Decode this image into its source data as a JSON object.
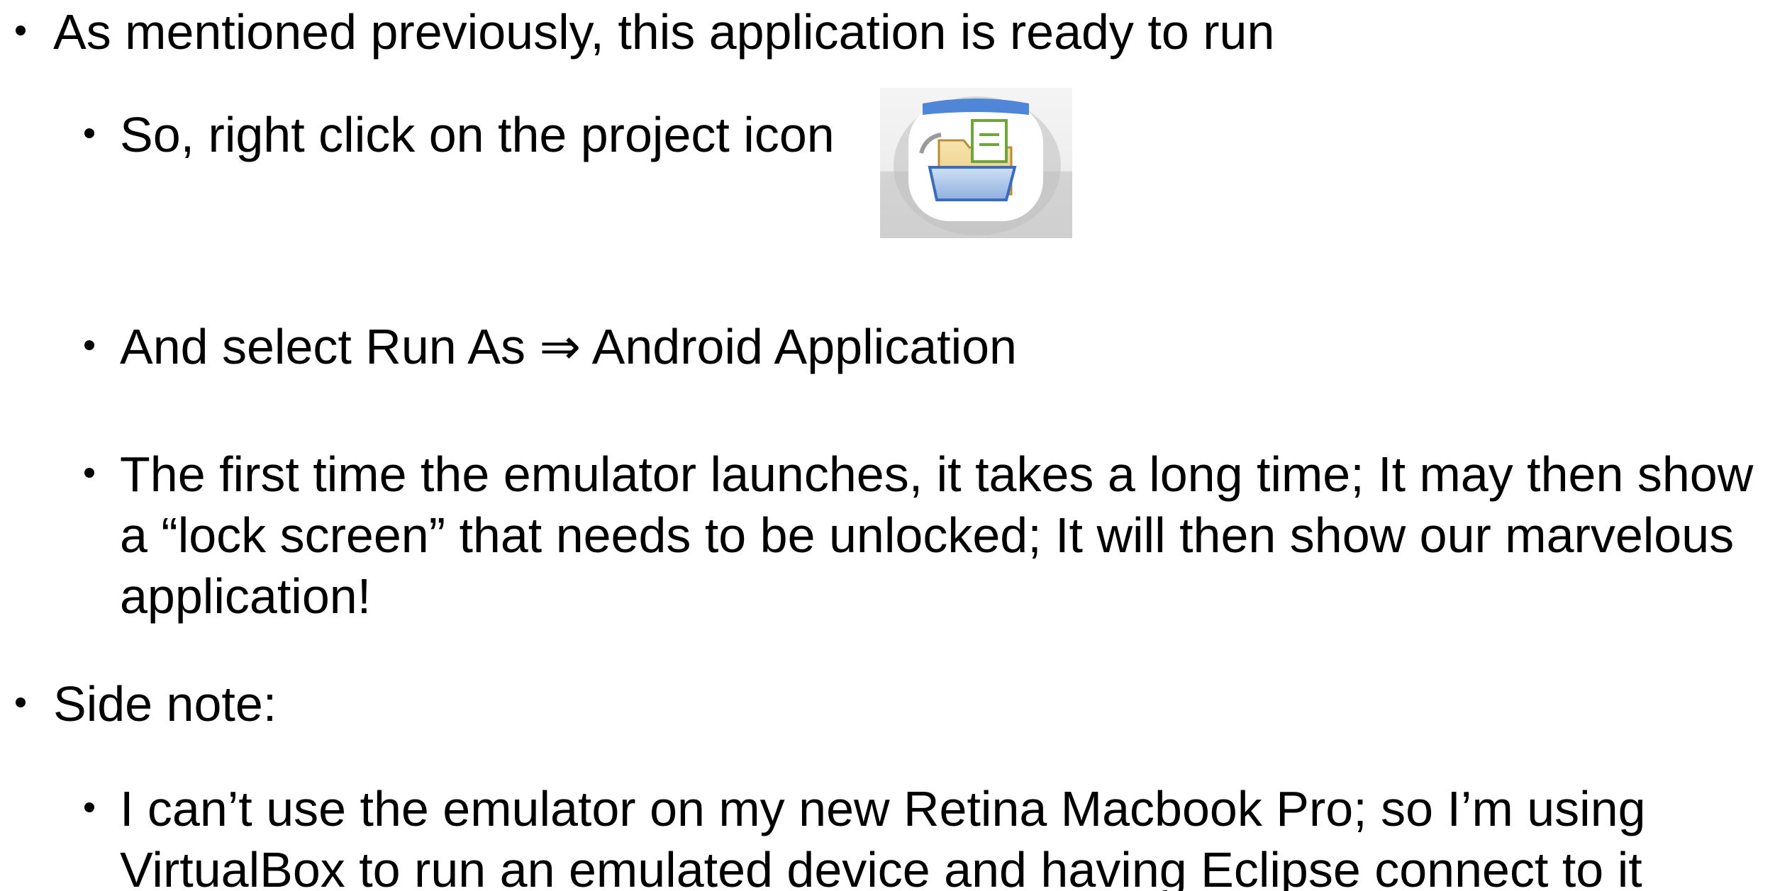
{
  "bullets": [
    {
      "level": 1,
      "text": "As mentioned previously, this application is ready to run"
    },
    {
      "level": 2,
      "text": "So, right click on the project icon"
    },
    {
      "level": 2,
      "text": "And select Run As ⇒ Android Application"
    },
    {
      "level": 2,
      "text": "The first time the emulator launches, it takes a long time; It may then show a “lock screen” that needs to be unlocked; It will then show our marvelous application!"
    },
    {
      "level": 1,
      "text": "Side note:"
    },
    {
      "level": 2,
      "text": "I can’t use the emulator on my new Retina Macbook Pro; so I’m using VirtualBox to run an emulated device and having Eclipse connect to it"
    }
  ],
  "icons": {
    "project_icon": "android-project-folder-icon"
  }
}
